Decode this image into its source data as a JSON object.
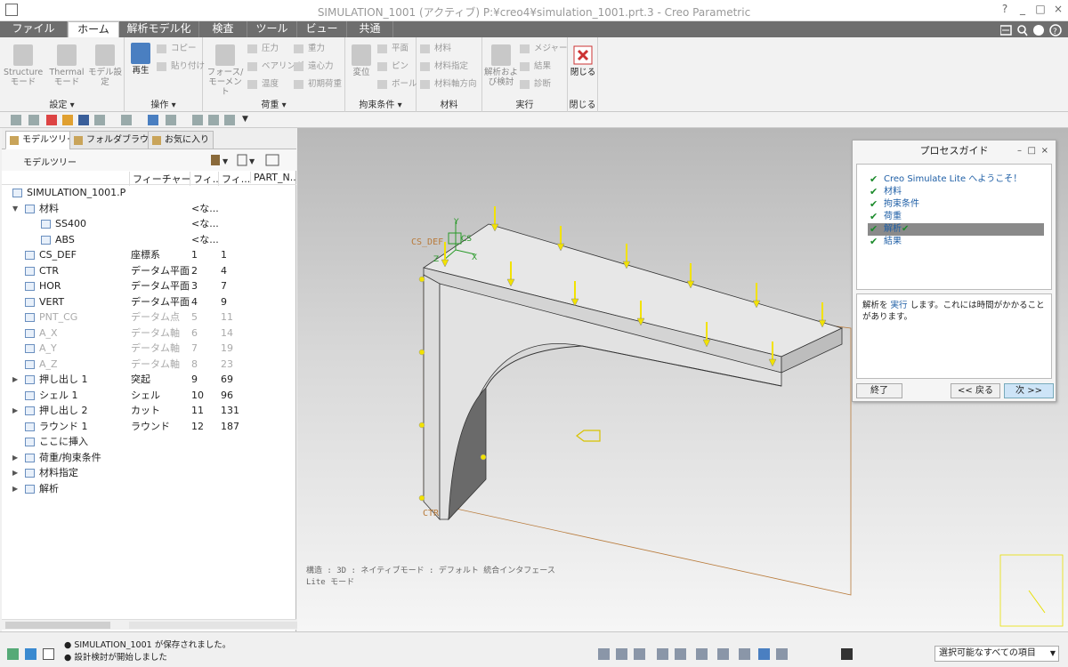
{
  "window": {
    "title": "SIMULATION_1001 (アクティブ) P:¥creo4¥simulation_1001.prt.3 - Creo Parametric",
    "controls": {
      "help": "?",
      "minimize": "_",
      "maximize": "□",
      "close": "×"
    }
  },
  "tabs": [
    {
      "label": "ファイル"
    },
    {
      "label": "ホーム",
      "active": true
    },
    {
      "label": "解析モデル化"
    },
    {
      "label": "検査"
    },
    {
      "label": "ツール"
    },
    {
      "label": "ビュー"
    },
    {
      "label": "共通"
    }
  ],
  "ribbon": {
    "groups": [
      {
        "label": "設定 ▾"
      },
      {
        "label": "操作 ▾"
      },
      {
        "label": "荷重 ▾"
      },
      {
        "label": "拘束条件 ▾"
      },
      {
        "label": "材料"
      },
      {
        "label": "実行"
      },
      {
        "label": "閉じる"
      }
    ],
    "setup": {
      "structure": "Structure\nモード",
      "thermal": "Thermal\nモード",
      "model_setup": "モデル設\n定"
    },
    "ops": {
      "regen": "再生",
      "copy": "コピー",
      "paste": "貼り付け"
    },
    "loads": {
      "force": "フォース/\nモーメント",
      "pressure": "圧力",
      "bearing": "ベアリング",
      "temp": "温度",
      "gravity": "重力",
      "centrifugal": "遠心力",
      "preload": "初期荷重"
    },
    "constraints": {
      "displacement": "変位",
      "plane": "平面",
      "pin": "ピン",
      "ball": "ボール"
    },
    "material": {
      "material": "材料",
      "assign": "材料指定",
      "orientation": "材料軸方向"
    },
    "run": {
      "analyses": "解析およ\nび検討",
      "measures": "メジャー",
      "results": "結果",
      "diagnostics": "診断"
    },
    "close": {
      "close": "閉じる"
    }
  },
  "panel": {
    "tabs": [
      "モデルツリー",
      "フォルダブラウザ",
      "お気に入り"
    ],
    "title": "モデルツリー",
    "columns": [
      "フィーチャー...",
      "フィ...",
      "フィ...",
      "PART_N..."
    ]
  },
  "tree": [
    {
      "name": "SIMULATION_1001.PRT",
      "type": "",
      "id": "",
      "num": "",
      "exp": "",
      "indent": 0,
      "gray": false
    },
    {
      "name": "材料",
      "type": "",
      "id": "<な...",
      "num": "",
      "exp": "▼",
      "indent": 1,
      "gray": false
    },
    {
      "name": "SS400",
      "type": "",
      "id": "<な...",
      "num": "",
      "exp": "",
      "indent": 2,
      "gray": false
    },
    {
      "name": "ABS",
      "type": "",
      "id": "<な...",
      "num": "",
      "exp": "",
      "indent": 2,
      "gray": false
    },
    {
      "name": "CS_DEF",
      "type": "座標系",
      "id": "1",
      "num": "1",
      "exp": "",
      "indent": 1,
      "gray": false
    },
    {
      "name": "CTR",
      "type": "データム平面",
      "id": "2",
      "num": "4",
      "exp": "",
      "indent": 1,
      "gray": false
    },
    {
      "name": "HOR",
      "type": "データム平面",
      "id": "3",
      "num": "7",
      "exp": "",
      "indent": 1,
      "gray": false
    },
    {
      "name": "VERT",
      "type": "データム平面",
      "id": "4",
      "num": "9",
      "exp": "",
      "indent": 1,
      "gray": false
    },
    {
      "name": "PNT_CG",
      "type": "データム点",
      "id": "5",
      "num": "11",
      "exp": "",
      "indent": 1,
      "gray": true
    },
    {
      "name": "A_X",
      "type": "データム軸",
      "id": "6",
      "num": "14",
      "exp": "",
      "indent": 1,
      "gray": true
    },
    {
      "name": "A_Y",
      "type": "データム軸",
      "id": "7",
      "num": "19",
      "exp": "",
      "indent": 1,
      "gray": true
    },
    {
      "name": "A_Z",
      "type": "データム軸",
      "id": "8",
      "num": "23",
      "exp": "",
      "indent": 1,
      "gray": true
    },
    {
      "name": "押し出し 1",
      "type": "突起",
      "id": "9",
      "num": "69",
      "exp": "▶",
      "indent": 1,
      "gray": false
    },
    {
      "name": "シェル 1",
      "type": "シェル",
      "id": "10",
      "num": "96",
      "exp": "",
      "indent": 1,
      "gray": false
    },
    {
      "name": "押し出し 2",
      "type": "カット",
      "id": "11",
      "num": "131",
      "exp": "▶",
      "indent": 1,
      "gray": false
    },
    {
      "name": "ラウンド 1",
      "type": "ラウンド",
      "id": "12",
      "num": "187",
      "exp": "",
      "indent": 1,
      "gray": false
    },
    {
      "name": "ここに挿入",
      "type": "",
      "id": "",
      "num": "",
      "exp": "",
      "indent": 1,
      "gray": false
    },
    {
      "name": "荷重/拘束条件",
      "type": "",
      "id": "",
      "num": "",
      "exp": "▶",
      "indent": 1,
      "gray": false
    },
    {
      "name": "材料指定",
      "type": "",
      "id": "",
      "num": "",
      "exp": "▶",
      "indent": 1,
      "gray": false
    },
    {
      "name": "解析",
      "type": "",
      "id": "",
      "num": "",
      "exp": "▶",
      "indent": 1,
      "gray": false
    }
  ],
  "viewport": {
    "labels": {
      "cs": "CS_DEF",
      "csys": "CS",
      "ctr": "CTR",
      "x": "X",
      "y": "Y",
      "z": "Z"
    },
    "info1": "構造 : 3D : ネイティブモード : デフォルト 統合インタフェース",
    "info2": "Lite モード"
  },
  "process_guide": {
    "title": "プロセスガイド",
    "items": [
      {
        "label": "Creo Simulate Lite へようこそ！",
        "selected": false
      },
      {
        "label": "材料",
        "selected": false
      },
      {
        "label": "拘束条件",
        "selected": false
      },
      {
        "label": "荷重",
        "selected": false
      },
      {
        "label": "解析",
        "selected": true
      },
      {
        "label": "結果",
        "selected": false
      }
    ],
    "desc_pre": "解析を ",
    "desc_link": "実行",
    "desc_post": " します。これには時間がかかることがあります。",
    "btn_end": "終了",
    "btn_back": "<< 戻る",
    "btn_next": "次 >>"
  },
  "status": {
    "msg1": "SIMULATION_1001 が保存されました。",
    "msg2": "設計検討が開始しました",
    "filter": "選択可能なすべての項目"
  }
}
